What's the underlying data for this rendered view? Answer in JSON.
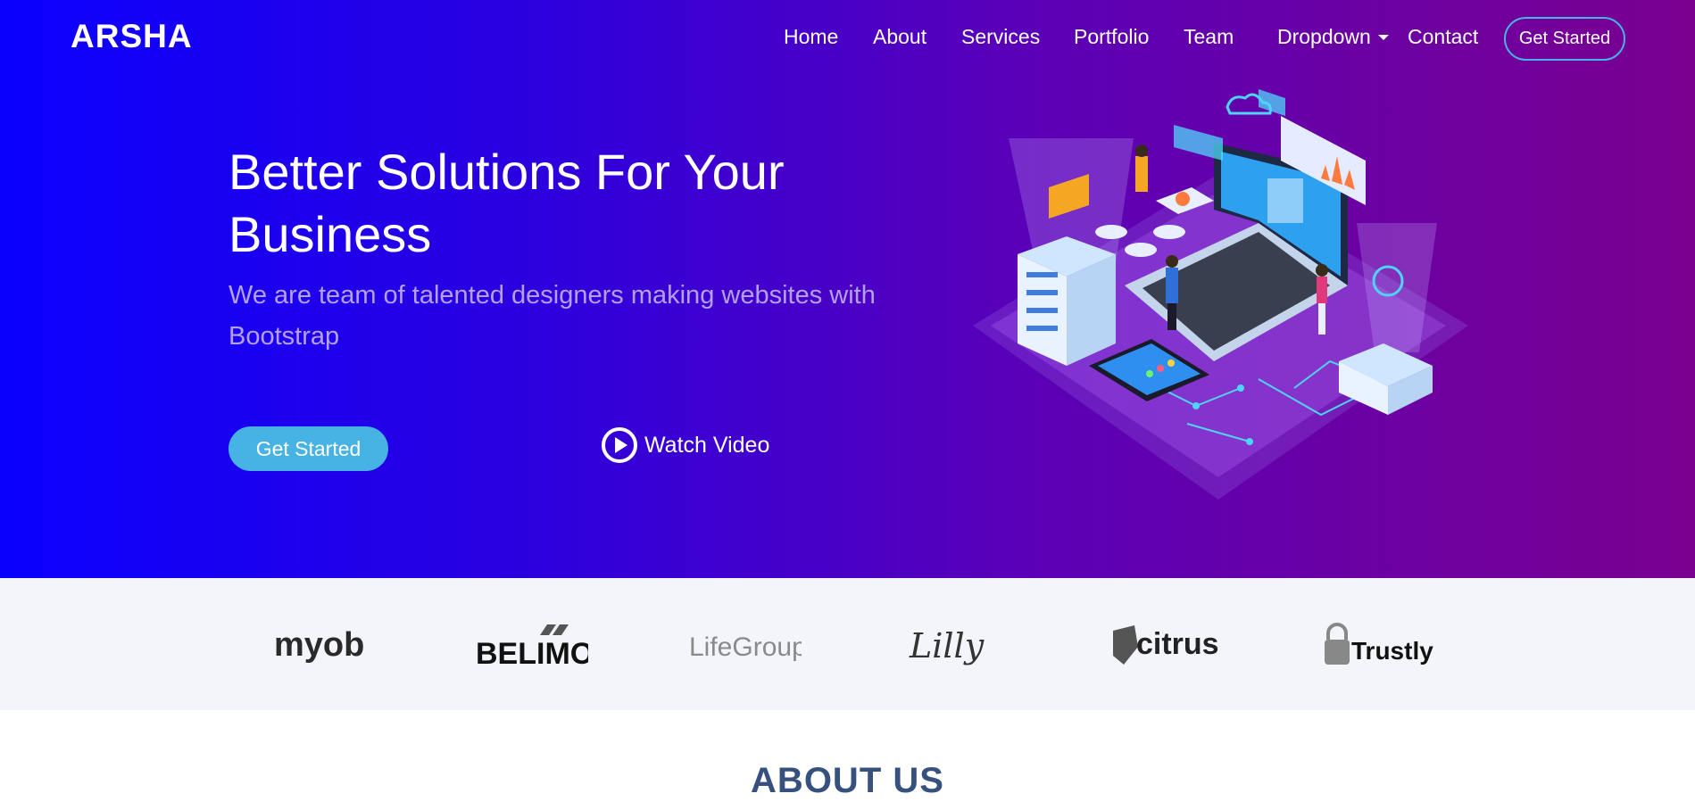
{
  "brand": {
    "logo": "ARSHA"
  },
  "nav": {
    "items": [
      {
        "label": "Home"
      },
      {
        "label": "About"
      },
      {
        "label": "Services"
      },
      {
        "label": "Portfolio"
      },
      {
        "label": "Team"
      },
      {
        "label": "Dropdown"
      },
      {
        "label": "Contact"
      }
    ],
    "cta": "Get Started"
  },
  "hero": {
    "title": "Better Solutions For Your Business",
    "subtitle": "We are team of talented designers making websites with Bootstrap",
    "primary_button": "Get Started",
    "video_link": "Watch Video"
  },
  "clients": [
    {
      "name": "myob"
    },
    {
      "name": "BELIMO"
    },
    {
      "name": "LifeGroups"
    },
    {
      "name": "Lilly"
    },
    {
      "name": "citrus"
    },
    {
      "name": "Trustly"
    }
  ],
  "about": {
    "title": "ABOUT US"
  },
  "colors": {
    "accent": "#47b2e4",
    "hero_gradient_start": "#0a00ff",
    "hero_gradient_end": "#7a0090",
    "heading_dark": "#37517e",
    "clients_bg": "#f3f5fa"
  }
}
